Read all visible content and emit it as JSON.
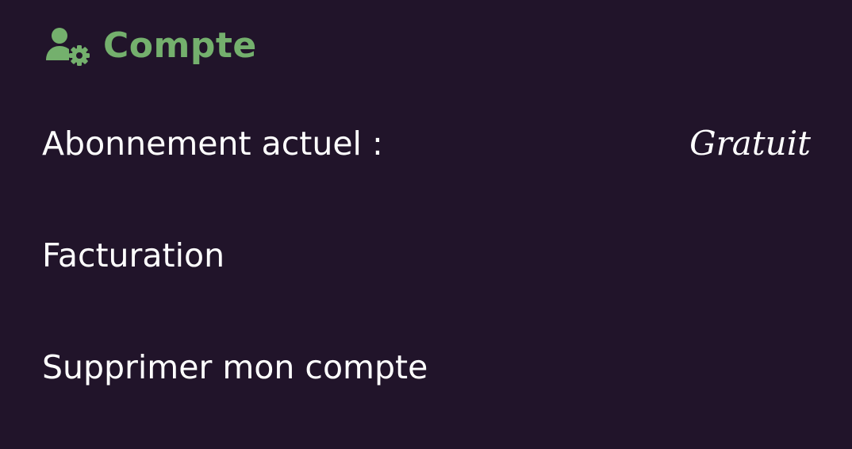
{
  "header": {
    "title": "Compte",
    "icon": "user-gear-icon",
    "accent_color": "#74b06d"
  },
  "account": {
    "plan_label": "Abonnement actuel :",
    "plan_value": "Gratuit",
    "billing_label": "Facturation",
    "delete_label": "Supprimer mon compte"
  },
  "theme": {
    "background": "#21142a",
    "text": "#ffffff"
  }
}
